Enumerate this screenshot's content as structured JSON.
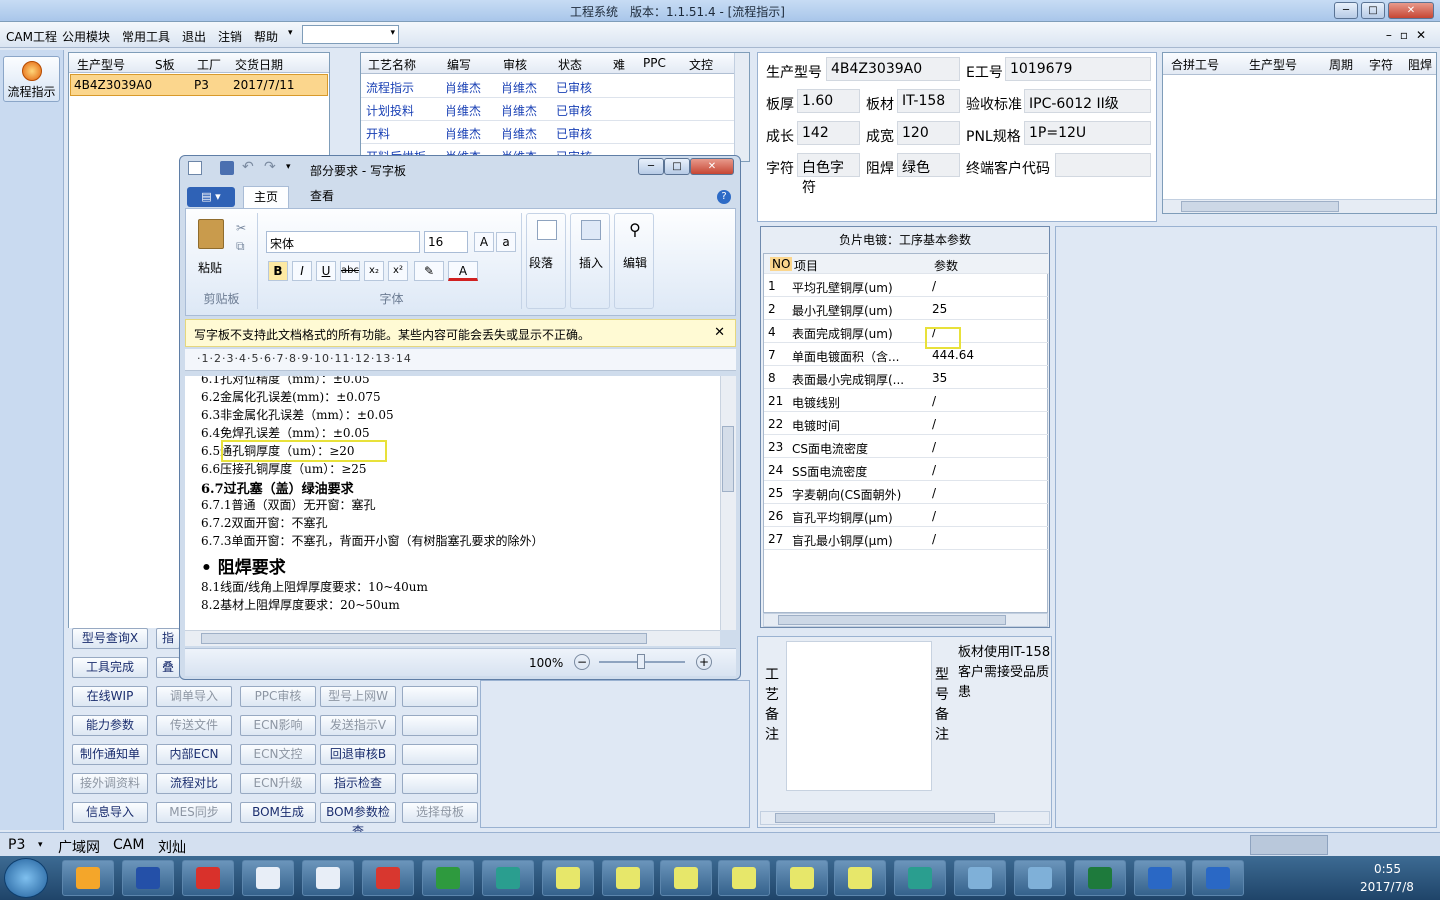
{
  "window": {
    "title": "工程系统　版本：1.1.51.4 - [流程指示]"
  },
  "menu": {
    "items": [
      "CAM工程",
      "公用模块",
      "常用工具",
      "退出",
      "注销",
      "帮助"
    ]
  },
  "left_nav": {
    "flow_label": "流程指示"
  },
  "order_table": {
    "headers": [
      "生产型号",
      "S板",
      "工厂",
      "交货日期"
    ],
    "rows": [
      [
        "4B4Z3039A0",
        "",
        "P3",
        "2017/7/11"
      ]
    ]
  },
  "process_table": {
    "headers": [
      "工艺名称",
      "编写",
      "审核",
      "状态",
      "难",
      "PPC",
      "文控"
    ],
    "rows": [
      [
        "流程指示",
        "肖维杰",
        "肖维杰",
        "已审核"
      ],
      [
        "计划投料",
        "肖维杰",
        "肖维杰",
        "已审核"
      ],
      [
        "开料",
        "肖维杰",
        "肖维杰",
        "已审核"
      ],
      [
        "开料后烘板",
        "肖维杰",
        "肖维杰",
        "已审核"
      ]
    ]
  },
  "info": {
    "model_label": "生产型号",
    "model": "4B4Z3039A0",
    "eno_label": "E工号",
    "eno": "1019679",
    "thick_label": "板厚",
    "thick": "1.60",
    "material_label": "板材",
    "material": "IT-158",
    "std_label": "验收标准",
    "std": "IPC-6012 II级",
    "len_label": "成长",
    "len": "142",
    "wid_label": "成宽",
    "wid": "120",
    "pnl_label": "PNL规格",
    "pnl": "1P=12U",
    "char_label": "字符",
    "char": "白色字符",
    "mask_label": "阻焊",
    "mask": "绿色",
    "cust_label": "终端客户代码",
    "cust": ""
  },
  "merge_table": {
    "headers": [
      "合拼工号",
      "生产型号",
      "周期",
      "字符",
      "阻焊"
    ]
  },
  "params": {
    "caption": "负片电镀：工序基本参数",
    "headers": [
      "NO",
      "项目",
      "参数"
    ],
    "rows": [
      [
        "1",
        "平均孔壁铜厚(um)",
        "/"
      ],
      [
        "2",
        "最小孔壁铜厚(um)",
        "25"
      ],
      [
        "4",
        "表面完成铜厚(um)",
        "/"
      ],
      [
        "7",
        "单面电镀面积（含...",
        "444.64"
      ],
      [
        "8",
        "表面最小完成铜厚(...",
        "35"
      ],
      [
        "21",
        "电镀线别",
        "/"
      ],
      [
        "22",
        "电镀时间",
        "/"
      ],
      [
        "23",
        "CS面电流密度",
        "/"
      ],
      [
        "24",
        "SS面电流密度",
        "/"
      ],
      [
        "25",
        "字麦朝向(CS面朝外)",
        "/"
      ],
      [
        "26",
        "盲孔平均铜厚(μm)",
        "/"
      ],
      [
        "27",
        "盲孔最小铜厚(μm)",
        "/"
      ]
    ]
  },
  "notes": {
    "proc_label": "工艺备注",
    "model_label": "型号备注",
    "model_text_1": "板材使用IT-158",
    "model_text_2": "客户需接受品质",
    "model_text_3": "患"
  },
  "buttons": [
    [
      "型号查询X",
      "指"
    ],
    [
      "工具完成",
      "叠"
    ],
    [
      "在线WIP",
      "调单导入",
      "PPC审核",
      "型号上网W",
      ""
    ],
    [
      "能力参数",
      "传送文件",
      "ECN影响",
      "发送指示V",
      ""
    ],
    [
      "制作通知单",
      "内部ECN",
      "ECN文控",
      "回退审核B",
      ""
    ],
    [
      "接外调资料",
      "流程对比",
      "ECN升级",
      "指示检查",
      ""
    ],
    [
      "信息导入",
      "MES同步",
      "BOM生成",
      "BOM参数检查",
      "选择母板"
    ]
  ],
  "status": {
    "factory": "P3",
    "net": "广域网",
    "cam": "CAM",
    "user": "刘灿"
  },
  "taskbar": {
    "time": "0:55",
    "date": "2017/7/8"
  },
  "wordpad": {
    "title": "部分要求 - 写字板",
    "tabs": [
      "主页",
      "查看"
    ],
    "paste": "粘贴",
    "clipboard": "剪贴板",
    "font": "宋体",
    "size": "16",
    "font_group": "字体",
    "para": "段落",
    "insert": "插入",
    "edit": "编辑",
    "info": "写字板不支持此文档格式的所有功能。某些内容可能会丢失或显示不正确。",
    "zoom": "100%",
    "lines": [
      "6.1孔对位精度（mm）：±0.05",
      "6.2金属化孔误差(mm)：±0.075",
      "6.3非金属化孔误差（mm）：±0.05",
      "6.4免焊孔误差（mm）：±0.05",
      "6.5通孔铜厚度（um）：≥20",
      "6.6压接孔铜厚度（um）：≥25",
      "6.7过孔塞（盖）绿油要求",
      "6.7.1普通（双面）无开窗：塞孔",
      "6.7.2双面开窗：不塞孔",
      "6.7.3单面开窗：不塞孔，背面开小窗（有树脂塞孔要求的除外）",
      "• 阻焊要求",
      "8.1线面/线角上阻焊厚度要求：10~40um",
      "8.2基材上阻焊厚度要求：20~50um"
    ]
  }
}
